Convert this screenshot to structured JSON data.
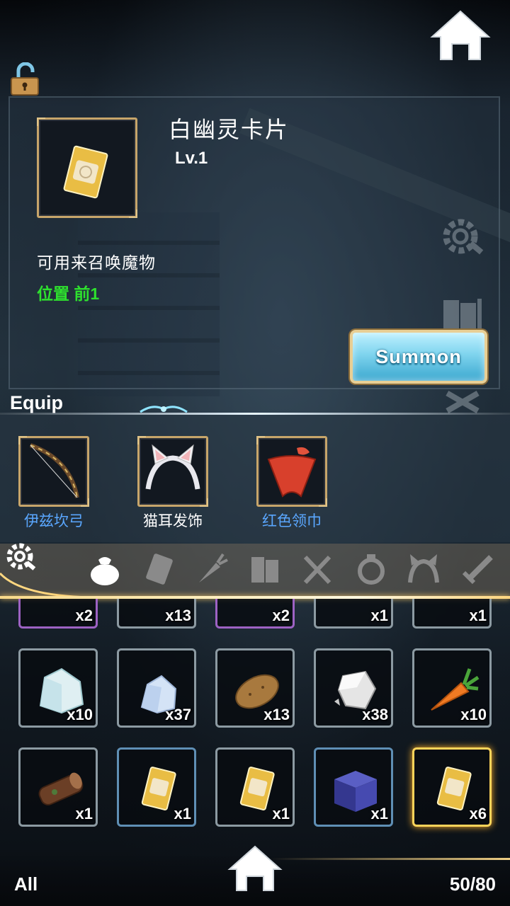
{
  "item_detail": {
    "name": "白幽灵卡片",
    "level": "Lv.1",
    "description": "可用来召唤魔物",
    "position": "位置 前1",
    "summon_label": "Summon"
  },
  "equip": {
    "title": "Equip",
    "slots": [
      {
        "label": "伊兹坎弓",
        "icon": "bow-icon",
        "color": "#5aa7ff"
      },
      {
        "label": "猫耳发饰",
        "icon": "cat-ear-headband-icon",
        "color": "#ffffff"
      },
      {
        "label": "红色领巾",
        "icon": "red-scarf-icon",
        "color": "#5aa7ff"
      }
    ]
  },
  "categories": [
    "bag-icon",
    "card-icon",
    "carrot-icon",
    "book-icon",
    "fork-knife-icon",
    "ring-icon",
    "headband-icon",
    "sword-icon"
  ],
  "inventory": {
    "partial_row": [
      {
        "count": "x2",
        "border": "purple"
      },
      {
        "count": "x13",
        "border": "gray"
      },
      {
        "count": "x2",
        "border": "purple"
      },
      {
        "count": "x1",
        "border": "gray"
      },
      {
        "count": "x1",
        "border": "gray"
      }
    ],
    "row2": [
      {
        "count": "x10",
        "icon": "white-crystal-icon",
        "border": "gray"
      },
      {
        "count": "x37",
        "icon": "ice-crystal-icon",
        "border": "gray"
      },
      {
        "count": "x13",
        "icon": "potato-icon",
        "border": "gray"
      },
      {
        "count": "x38",
        "icon": "silver-ore-icon",
        "border": "gray"
      },
      {
        "count": "x10",
        "icon": "carrot-icon",
        "border": "gray"
      }
    ],
    "row3": [
      {
        "count": "x1",
        "icon": "wood-log-icon",
        "border": "gray"
      },
      {
        "count": "x1",
        "icon": "card-icon",
        "border": "blue"
      },
      {
        "count": "x1",
        "icon": "card-icon",
        "border": "gray"
      },
      {
        "count": "x1",
        "icon": "blue-box-icon",
        "border": "blue"
      },
      {
        "count": "x6",
        "icon": "card-icon",
        "border": "sel"
      }
    ]
  },
  "footer": {
    "filter_label": "All",
    "capacity": "50/80"
  }
}
